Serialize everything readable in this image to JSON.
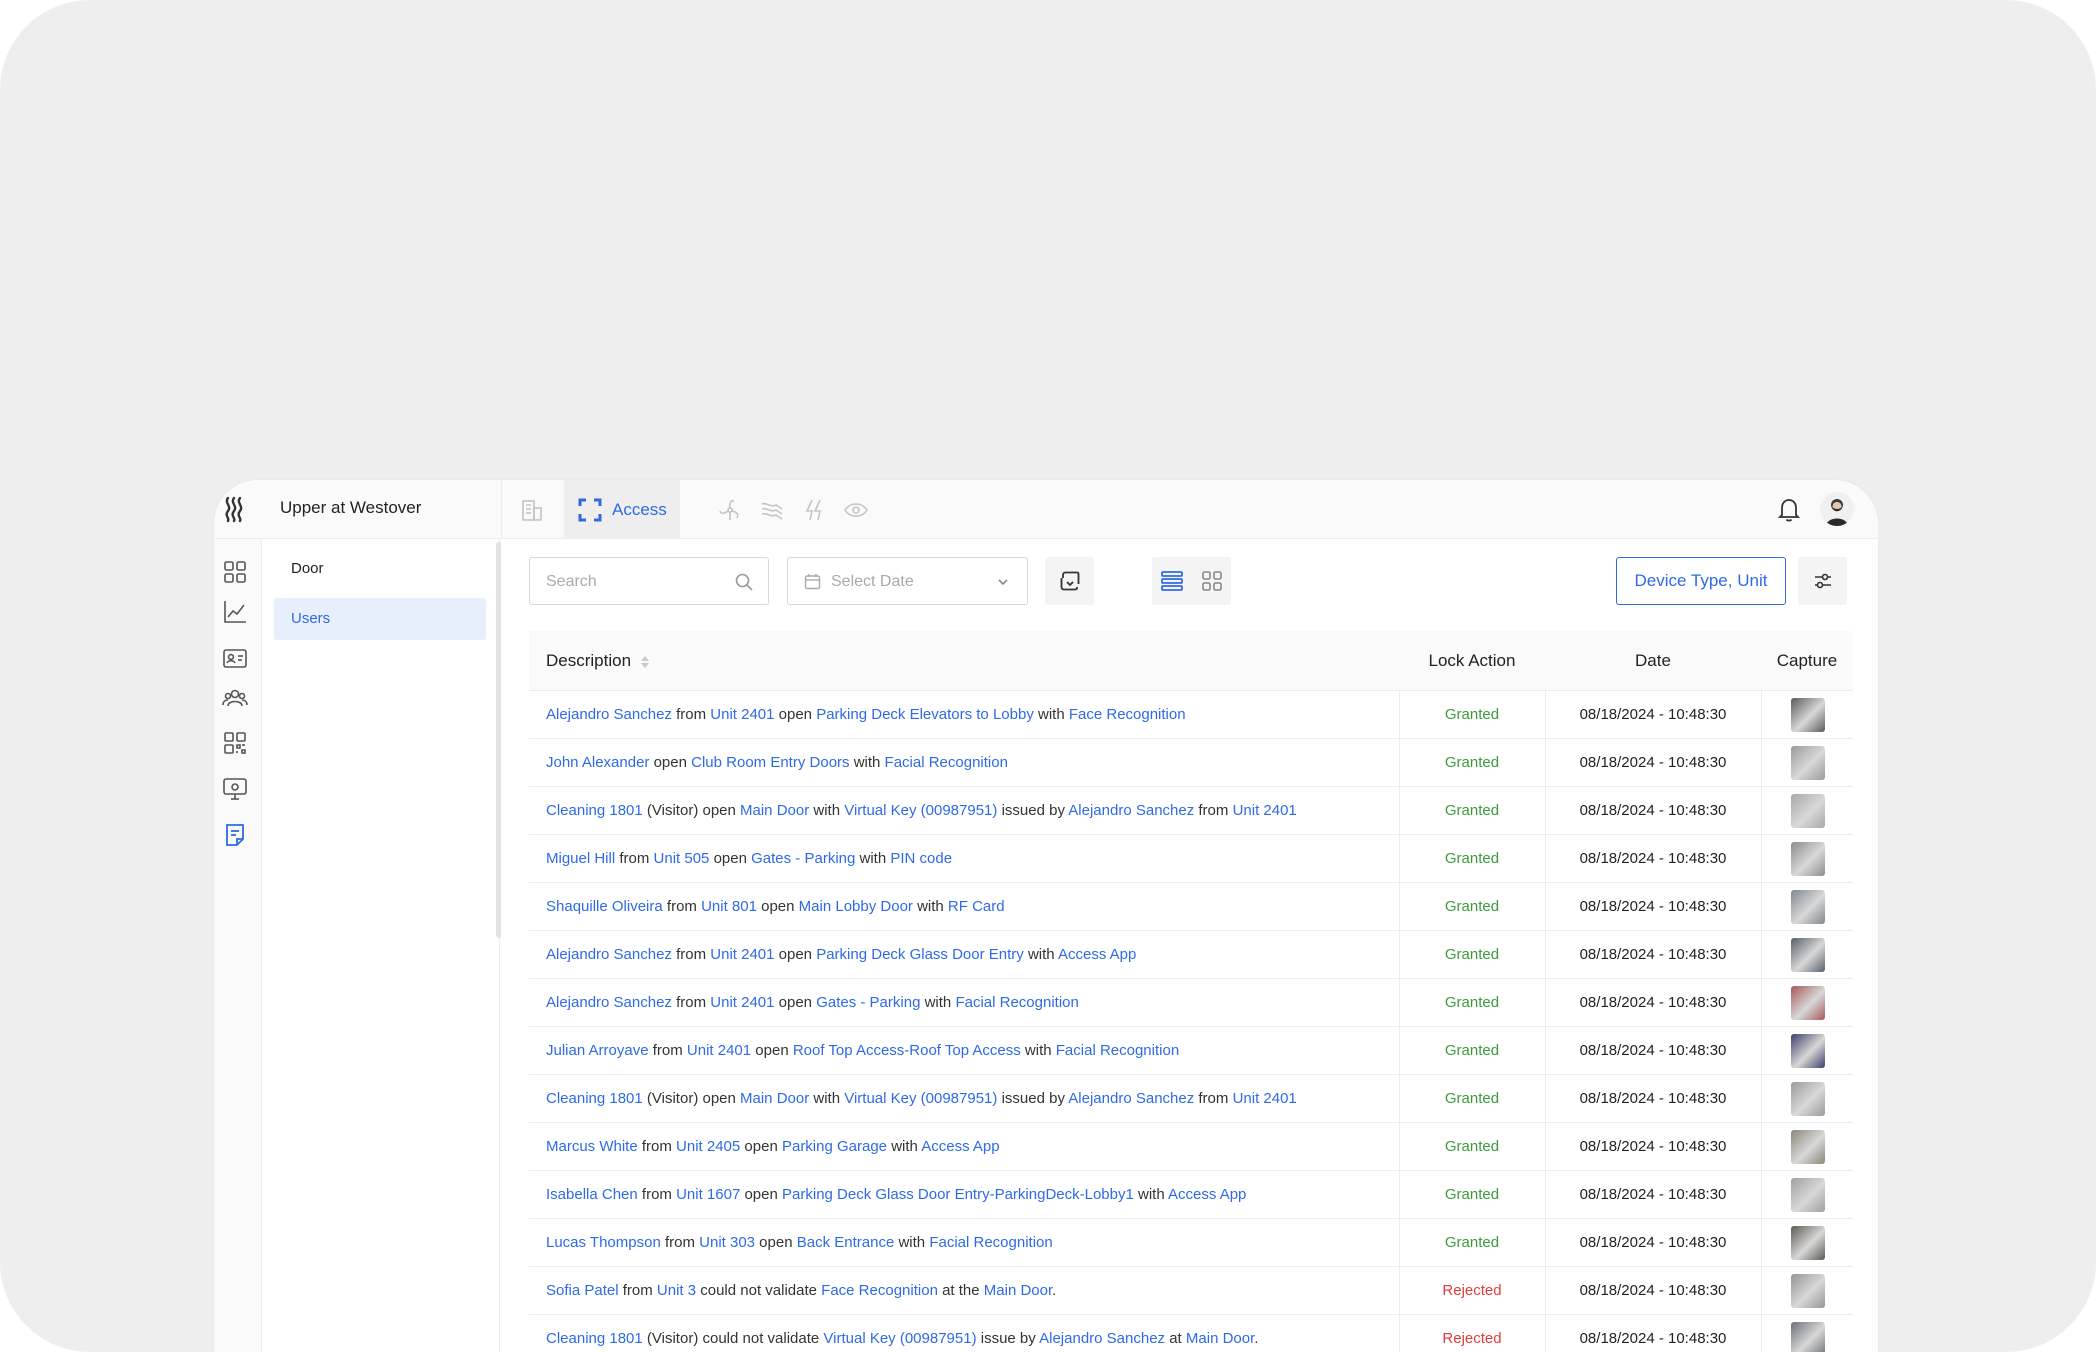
{
  "header": {
    "site_title": "Upper at Westover",
    "active_module": "Access",
    "modules": [
      "building-icon",
      "access-icon",
      "fan-icon",
      "wind-icon",
      "energy-icon",
      "sensor-icon"
    ]
  },
  "sidebar": {
    "items": [
      {
        "label": "Door",
        "active": false
      },
      {
        "label": "Users",
        "active": true
      }
    ]
  },
  "toolbar": {
    "search_placeholder": "Search",
    "date_placeholder": "Select Date",
    "filter_label": "Device Type, Unit"
  },
  "table": {
    "columns": {
      "description": "Description",
      "lock_action": "Lock Action",
      "date": "Date",
      "capture": "Capture"
    },
    "rows": [
      {
        "segments": [
          {
            "t": "Alejandro Sanchez",
            "link": true
          },
          {
            "t": " from "
          },
          {
            "t": "Unit 2401",
            "link": true
          },
          {
            "t": " open "
          },
          {
            "t": "Parking Deck Elevators to Lobby",
            "link": true
          },
          {
            "t": " with "
          },
          {
            "t": "Face Recognition",
            "link": true
          }
        ],
        "action": "Granted",
        "date": "08/18/2024 - 10:48:30",
        "capture": "#5a5a5a"
      },
      {
        "segments": [
          {
            "t": "John Alexander",
            "link": true
          },
          {
            "t": " open "
          },
          {
            "t": "Club Room Entry Doors",
            "link": true
          },
          {
            "t": " with "
          },
          {
            "t": "Facial Recognition",
            "link": true
          }
        ],
        "action": "Granted",
        "date": "08/18/2024 - 10:48:30",
        "capture": "#9a9a9a"
      },
      {
        "segments": [
          {
            "t": "Cleaning 1801",
            "link": true
          },
          {
            "t": " (Visitor) open "
          },
          {
            "t": "Main Door",
            "link": true
          },
          {
            "t": " with "
          },
          {
            "t": "Virtual Key (00987951)",
            "link": true
          },
          {
            "t": " issued by "
          },
          {
            "t": "Alejandro Sanchez",
            "link": true
          },
          {
            "t": " from "
          },
          {
            "t": "Unit 2401",
            "link": true
          }
        ],
        "action": "Granted",
        "date": "08/18/2024 - 10:48:30",
        "capture": "#a8a8a8"
      },
      {
        "segments": [
          {
            "t": "Miguel Hill",
            "link": true
          },
          {
            "t": " from "
          },
          {
            "t": "Unit 505",
            "link": true
          },
          {
            "t": " open "
          },
          {
            "t": "Gates - Parking",
            "link": true
          },
          {
            "t": " with "
          },
          {
            "t": "PIN code",
            "link": true
          }
        ],
        "action": "Granted",
        "date": "08/18/2024 - 10:48:30",
        "capture": "#8c8c8c"
      },
      {
        "segments": [
          {
            "t": "Shaquille Oliveira",
            "link": true
          },
          {
            "t": " from "
          },
          {
            "t": "Unit 801",
            "link": true
          },
          {
            "t": " open "
          },
          {
            "t": "Main Lobby Door",
            "link": true
          },
          {
            "t": " with "
          },
          {
            "t": "RF Card",
            "link": true
          }
        ],
        "action": "Granted",
        "date": "08/18/2024 - 10:48:30",
        "capture": "#7f8890"
      },
      {
        "segments": [
          {
            "t": "Alejandro Sanchez",
            "link": true
          },
          {
            "t": " from "
          },
          {
            "t": "Unit 2401",
            "link": true
          },
          {
            "t": " open "
          },
          {
            "t": "Parking Deck Glass Door Entry",
            "link": true
          },
          {
            "t": " with "
          },
          {
            "t": "Access App",
            "link": true
          }
        ],
        "action": "Granted",
        "date": "08/18/2024 - 10:48:30",
        "capture": "#55606a"
      },
      {
        "segments": [
          {
            "t": "Alejandro Sanchez",
            "link": true
          },
          {
            "t": " from "
          },
          {
            "t": "Unit 2401",
            "link": true
          },
          {
            "t": " open "
          },
          {
            "t": "Gates - Parking",
            "link": true
          },
          {
            "t": " with "
          },
          {
            "t": "Facial Recognition",
            "link": true
          }
        ],
        "action": "Granted",
        "date": "08/18/2024 - 10:48:30",
        "capture": "#a5575a"
      },
      {
        "segments": [
          {
            "t": "Julian Arroyave",
            "link": true
          },
          {
            "t": " from "
          },
          {
            "t": "Unit 2401",
            "link": true
          },
          {
            "t": " open "
          },
          {
            "t": "Roof Top Access-Roof Top Access",
            "link": true
          },
          {
            "t": " with "
          },
          {
            "t": "Facial Recognition",
            "link": true
          }
        ],
        "action": "Granted",
        "date": "08/18/2024 - 10:48:30",
        "capture": "#3a3f6a"
      },
      {
        "segments": [
          {
            "t": "Cleaning 1801",
            "link": true
          },
          {
            "t": " (Visitor) open "
          },
          {
            "t": "Main Door",
            "link": true
          },
          {
            "t": " with "
          },
          {
            "t": "Virtual Key (00987951)",
            "link": true
          },
          {
            "t": " issued by "
          },
          {
            "t": "Alejandro Sanchez",
            "link": true
          },
          {
            "t": " from "
          },
          {
            "t": "Unit 2401",
            "link": true
          }
        ],
        "action": "Granted",
        "date": "08/18/2024 - 10:48:30",
        "capture": "#9a9c98"
      },
      {
        "segments": [
          {
            "t": "Marcus White",
            "link": true
          },
          {
            "t": " from "
          },
          {
            "t": "Unit 2405",
            "link": true
          },
          {
            "t": " open "
          },
          {
            "t": "Parking Garage",
            "link": true
          },
          {
            "t": " with "
          },
          {
            "t": "Access App",
            "link": true
          }
        ],
        "action": "Granted",
        "date": "08/18/2024 - 10:48:30",
        "capture": "#8a8678"
      },
      {
        "segments": [
          {
            "t": "Isabella Chen",
            "link": true
          },
          {
            "t": " from "
          },
          {
            "t": "Unit 1607",
            "link": true
          },
          {
            "t": " open "
          },
          {
            "t": "Parking Deck Glass Door Entry-ParkingDeck-Lobby1",
            "link": true
          },
          {
            "t": " with "
          },
          {
            "t": "Access App",
            "link": true
          }
        ],
        "action": "Granted",
        "date": "08/18/2024 - 10:48:30",
        "capture": "#9ea0a2"
      },
      {
        "segments": [
          {
            "t": "Lucas Thompson",
            "link": true
          },
          {
            "t": " from "
          },
          {
            "t": "Unit 303",
            "link": true
          },
          {
            "t": " open "
          },
          {
            "t": "Back Entrance",
            "link": true
          },
          {
            "t": " with "
          },
          {
            "t": "Facial Recognition",
            "link": true
          }
        ],
        "action": "Granted",
        "date": "08/18/2024 - 10:48:30",
        "capture": "#5c5a52"
      },
      {
        "segments": [
          {
            "t": "Sofia Patel",
            "link": true
          },
          {
            "t": " from "
          },
          {
            "t": "Unit 3",
            "link": true
          },
          {
            "t": " could not validate "
          },
          {
            "t": "Face Recognition",
            "link": true
          },
          {
            "t": " at the "
          },
          {
            "t": "Main Door",
            "link": true
          },
          {
            "t": "."
          }
        ],
        "action": "Rejected",
        "date": "08/18/2024 - 10:48:30",
        "capture": "#949494"
      },
      {
        "segments": [
          {
            "t": "Cleaning 1801",
            "link": true
          },
          {
            "t": " (Visitor) could not validate "
          },
          {
            "t": "Virtual Key (00987951)",
            "link": true
          },
          {
            "t": " issue by "
          },
          {
            "t": "Alejandro Sanchez",
            "link": true
          },
          {
            "t": " at "
          },
          {
            "t": "Main Door",
            "link": true
          },
          {
            "t": "."
          }
        ],
        "action": "Rejected",
        "date": "08/18/2024 - 10:48:30",
        "capture": "#6c7078"
      }
    ]
  },
  "colors": {
    "accent": "#2f6ae6",
    "granted": "#3d9a3d",
    "rejected": "#e53a3a"
  }
}
